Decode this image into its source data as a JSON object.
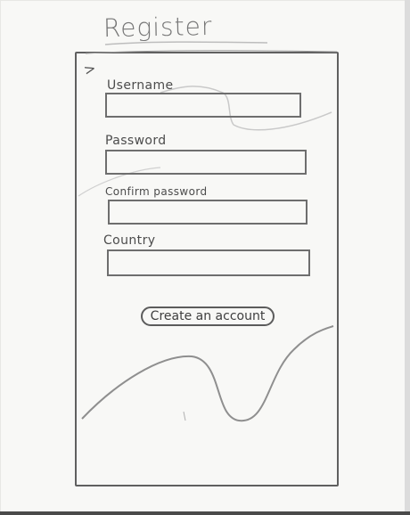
{
  "header": {
    "title": "Register"
  },
  "form": {
    "fields": [
      {
        "label": "Username",
        "value": ""
      },
      {
        "label": "Password",
        "value": ""
      },
      {
        "label": "Confirm password",
        "value": ""
      },
      {
        "label": "Country",
        "value": ""
      }
    ],
    "submit_label": "Create an account"
  },
  "colors": {
    "ink": "#606060",
    "paper": "#f8f8f6"
  }
}
